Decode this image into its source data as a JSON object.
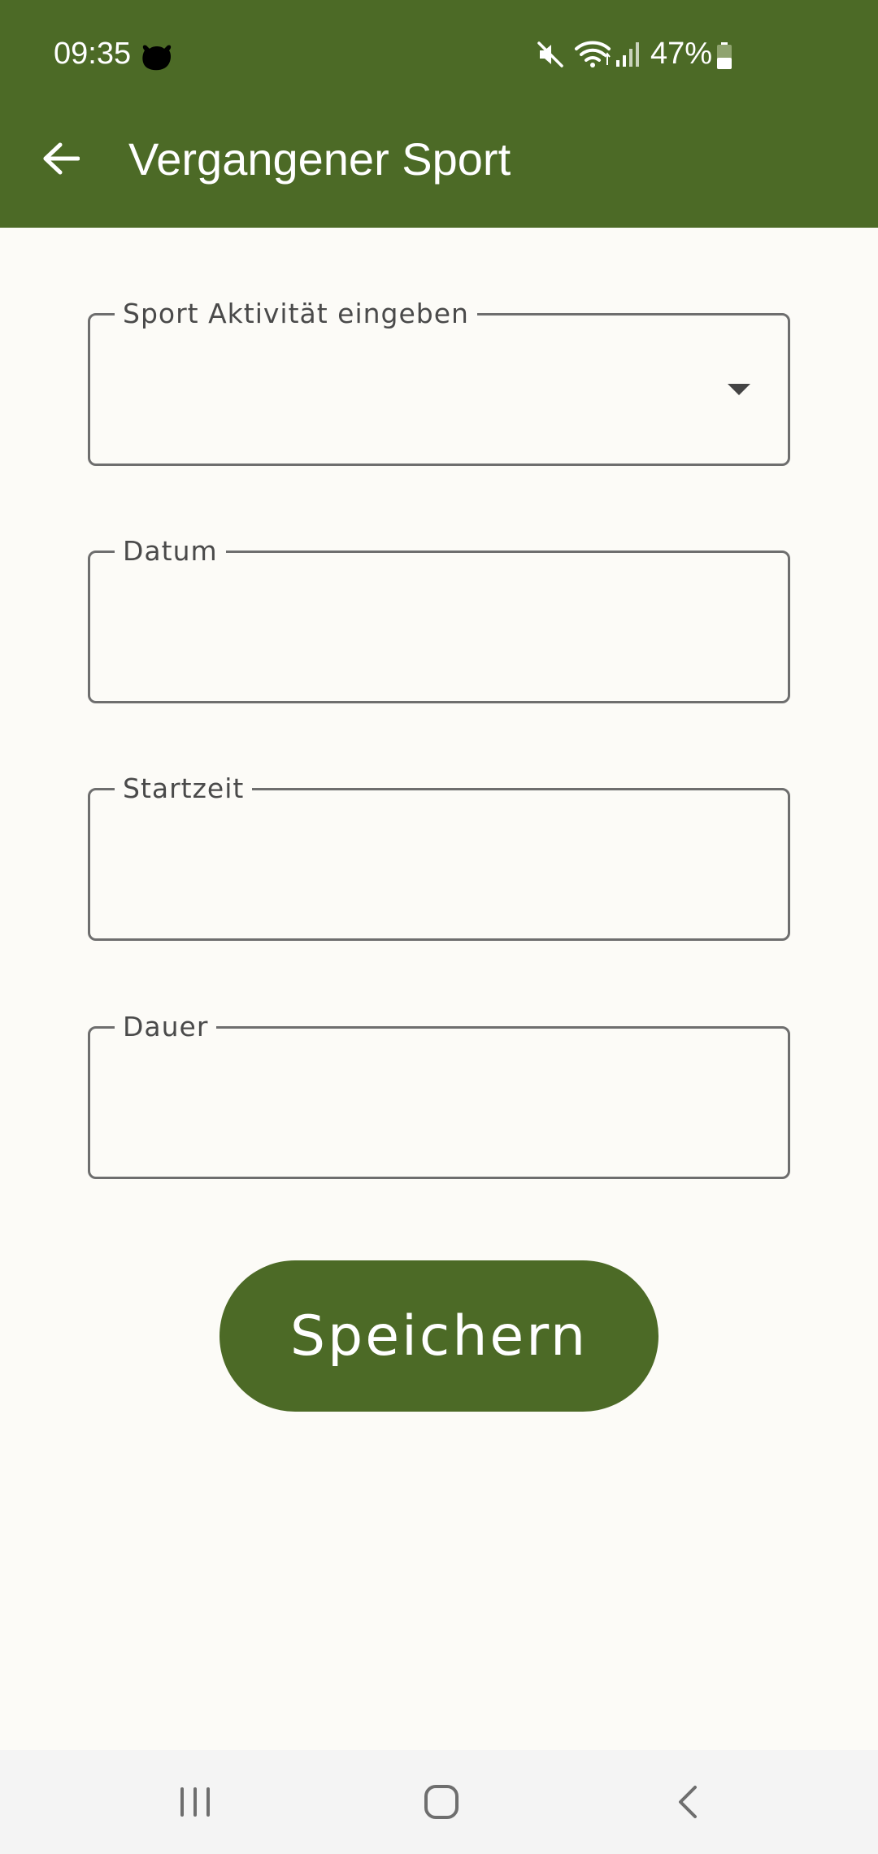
{
  "status_bar": {
    "time": "09:35",
    "app_icon": "cow-icon",
    "icons": [
      "mute-icon",
      "wifi-icon",
      "signal-icon"
    ],
    "battery_percent": "47%",
    "battery_level": 0.47
  },
  "app_bar": {
    "back_icon": "arrow-left-icon",
    "title": "Vergangener Sport"
  },
  "form": {
    "activity": {
      "label": "Sport Aktivität eingeben",
      "value": "",
      "icon": "dropdown-arrow-icon"
    },
    "date": {
      "label": "Datum",
      "value": ""
    },
    "start_time": {
      "label": "Startzeit",
      "value": ""
    },
    "duration": {
      "label": "Dauer",
      "value": ""
    }
  },
  "save_button": {
    "label": "Speichern"
  },
  "nav_bar": {
    "recents_icon": "recents-icon",
    "home_icon": "home-icon",
    "back_icon": "back-chevron-icon"
  },
  "colors": {
    "primary": "#4C6A26",
    "background": "#FCFBF7",
    "outline": "#6E6E6E",
    "label": "#4A4A4A",
    "nav_bar": "#F4F4F4"
  }
}
